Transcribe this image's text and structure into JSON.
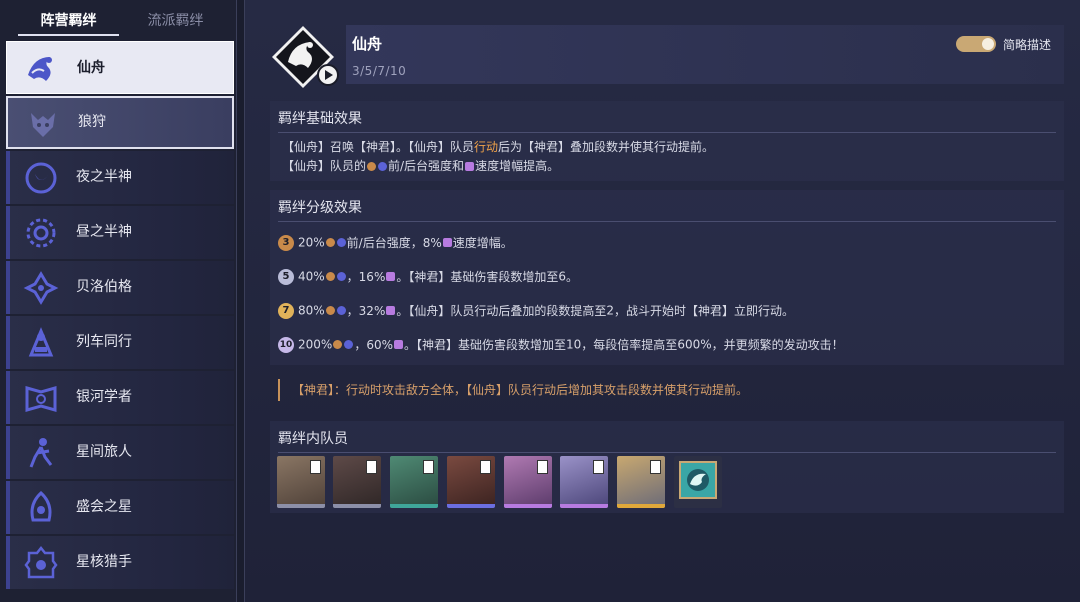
{
  "sidebar": {
    "tabs": [
      {
        "label": "阵营羁绊",
        "active": true
      },
      {
        "label": "流派羁绊",
        "active": false
      }
    ],
    "items": [
      {
        "label": "仙舟",
        "icon": "xianzhou-icon",
        "state": "selected"
      },
      {
        "label": "狼狩",
        "icon": "wolf-hunt-icon",
        "state": "hovered"
      },
      {
        "label": "夜之半神",
        "icon": "night-demigod-icon",
        "state": "normal"
      },
      {
        "label": "昼之半神",
        "icon": "day-demigod-icon",
        "state": "normal"
      },
      {
        "label": "贝洛伯格",
        "icon": "belobog-icon",
        "state": "normal"
      },
      {
        "label": "列车同行",
        "icon": "express-train-icon",
        "state": "normal"
      },
      {
        "label": "银河学者",
        "icon": "galaxy-scholar-icon",
        "state": "normal"
      },
      {
        "label": "星间旅人",
        "icon": "star-traveler-icon",
        "state": "normal"
      },
      {
        "label": "盛会之星",
        "icon": "pageant-star-icon",
        "state": "normal"
      },
      {
        "label": "星核猎手",
        "icon": "stellaron-hunter-icon",
        "state": "normal"
      }
    ]
  },
  "header": {
    "title": "仙舟",
    "thresholds": "3/5/7/10",
    "toggle_label": "简略描述",
    "toggle_on": true
  },
  "basic": {
    "title": "羁绊基础效果",
    "line1_a": "【仙舟】召唤【神君】。【仙舟】队员",
    "line1_hl": "行动",
    "line1_b": "后为【神君】叠加段数并使其行动提前。",
    "line2_a": "【仙舟】队员的",
    "line2_b": "前/后台强度和",
    "line2_c": "速度增幅提高。"
  },
  "tiers": {
    "title": "羁绊分级效果",
    "rows": [
      {
        "badge": "3",
        "badge_color": "#c98a4a",
        "a": "20%",
        "b": "前/后台强度，8%",
        "c": "速度增幅。",
        "d": "",
        "e": "",
        "f": "",
        "g": "",
        "h": ""
      },
      {
        "badge": "5",
        "badge_color": "#b9bcd8",
        "a": "40%",
        "b": "，16%",
        "c": "。【神君】基础伤害段数增加至",
        "d": "6",
        "e": "。",
        "f": "",
        "g": "",
        "h": ""
      },
      {
        "badge": "7",
        "badge_color": "#e0b25a",
        "a": "80%",
        "b": "，32%",
        "c": "。【仙舟】队员行动后叠加的段数提高至",
        "d": "2",
        "e": "，战斗开始时【神君】立即行动。",
        "f": "",
        "g": "",
        "h": ""
      },
      {
        "badge": "10",
        "badge_color": "#c6b8e8",
        "a": "200%",
        "b": "，60%",
        "c": "。【神君】基础伤害段数增加至",
        "d": "10",
        "e": "，每段倍率提高至",
        "f": "600%",
        "g": "，并更频繁的发动攻击！",
        "h": ""
      }
    ]
  },
  "note": "【神君】：行动时攻击敌方全体，【仙舟】队员行动后增加其攻击段数并使其行动提前。",
  "members": {
    "title": "羁绊内队员",
    "list": [
      {
        "name": "member-1",
        "bg": "#6b5a4c",
        "bar": "#8c8fa8"
      },
      {
        "name": "member-2",
        "bg": "#4a3b3a",
        "bar": "#8c8fa8"
      },
      {
        "name": "member-3",
        "bg": "#3f6a5c",
        "bar": "#3fa69a"
      },
      {
        "name": "member-4",
        "bg": "#5a3b36",
        "bar": "#6b6ee0"
      },
      {
        "name": "member-5",
        "bg": "#8a5f8c",
        "bar": "#b77be0"
      },
      {
        "name": "member-6",
        "bg": "#6f6a9a",
        "bar": "#b77be0"
      },
      {
        "name": "member-7",
        "bg": "#8a7a5a",
        "bar": "#e0a83a"
      },
      {
        "name": "member-8",
        "bg": "#2c5e6a",
        "bar": "#2c2f44"
      }
    ]
  },
  "colors": {
    "accent_orange": "#f0a24a",
    "toggle": "#c9a874",
    "nav_edge": "#3c4290"
  }
}
